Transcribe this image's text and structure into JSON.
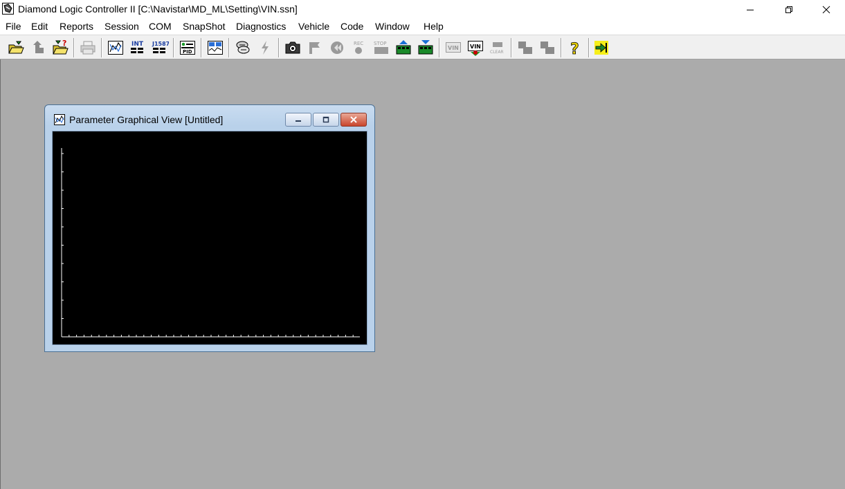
{
  "window": {
    "title": "Diamond Logic Controller II [C:\\Navistar\\MD_ML\\Setting\\VIN.ssn]",
    "controls": [
      "minimize-icon",
      "restore-icon",
      "close-icon"
    ]
  },
  "menu": {
    "items": [
      "File",
      "Edit",
      "Reports",
      "Session",
      "COM",
      "SnapShot",
      "Diagnostics",
      "Vehicle",
      "Code",
      "Window",
      "Help"
    ]
  },
  "toolbar": {
    "buttons": [
      {
        "icon": "open-folder-icon",
        "enabled": true
      },
      {
        "icon": "upload-icon",
        "enabled": false
      },
      {
        "icon": "open-folder-question-icon",
        "enabled": true
      },
      {
        "icon": "printer-icon",
        "enabled": false
      },
      {
        "icon": "graph-view-icon",
        "enabled": true
      },
      {
        "icon": "int-parameter-icon",
        "label": "INT",
        "enabled": true
      },
      {
        "icon": "j1587-parameter-icon",
        "label": "J1587",
        "enabled": true
      },
      {
        "icon": "pid-icon",
        "label": "PID",
        "enabled": true
      },
      {
        "icon": "dashboard-icon",
        "enabled": true
      },
      {
        "icon": "link-icon",
        "enabled": true
      },
      {
        "icon": "lightning-icon",
        "enabled": false
      },
      {
        "icon": "camera-icon",
        "enabled": true
      },
      {
        "icon": "flag-icon",
        "enabled": false
      },
      {
        "icon": "rewind-icon",
        "enabled": false
      },
      {
        "icon": "record-icon",
        "label": "REC",
        "enabled": false
      },
      {
        "icon": "stop-icon",
        "label": "STOP",
        "enabled": false
      },
      {
        "icon": "module-up-icon",
        "enabled": true
      },
      {
        "icon": "module-down-icon",
        "enabled": true
      },
      {
        "icon": "vin-icon",
        "label": "VIN",
        "enabled": false
      },
      {
        "icon": "vin-program-icon",
        "label": "VIN",
        "enabled": true
      },
      {
        "icon": "clear-icon",
        "label": "CLEAR",
        "enabled": false
      },
      {
        "icon": "step-back-icon",
        "enabled": false
      },
      {
        "icon": "step-forward-icon",
        "enabled": false
      },
      {
        "icon": "help-question-icon",
        "enabled": true
      },
      {
        "icon": "exit-arrow-icon",
        "enabled": true
      }
    ]
  },
  "child_window": {
    "title": "Parameter Graphical View [Untitled]",
    "controls": [
      "minimize-icon",
      "restore-icon",
      "close-icon"
    ]
  },
  "colors": {
    "mdi_background": "#ababab",
    "graph_background": "#000000",
    "axis": "#ffffff",
    "child_frame": "#b9d1ea",
    "close_button": "#c9462c"
  }
}
